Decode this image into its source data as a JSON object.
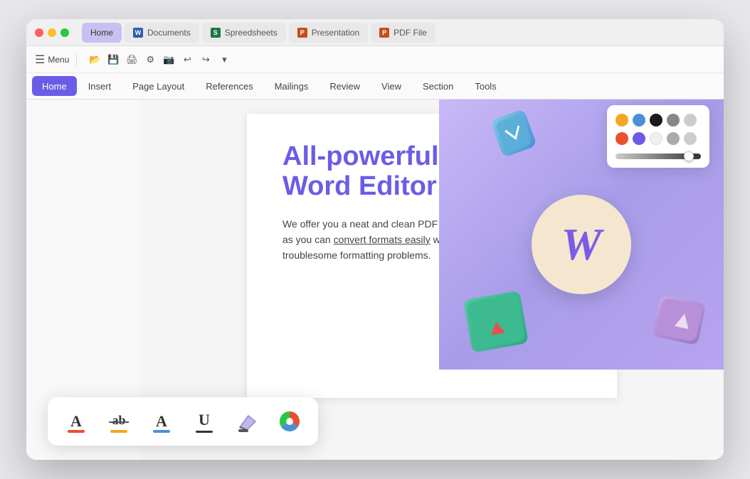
{
  "window": {
    "title": "Word Editor"
  },
  "titlebar": {
    "tabs": [
      {
        "id": "home",
        "label": "Home",
        "icon": null,
        "active": true
      },
      {
        "id": "documents",
        "label": "Documents",
        "icon": "word",
        "active": false
      },
      {
        "id": "spreadsheets",
        "label": "Spreedsheets",
        "icon": "sheets",
        "active": false
      },
      {
        "id": "presentation",
        "label": "Presentation",
        "icon": "ppt",
        "active": false
      },
      {
        "id": "pdf",
        "label": "PDF File",
        "icon": "pdf",
        "active": false
      }
    ]
  },
  "ribbon": {
    "nav_items": [
      {
        "id": "home",
        "label": "Home",
        "active": true
      },
      {
        "id": "insert",
        "label": "Insert",
        "active": false
      },
      {
        "id": "page_layout",
        "label": "Page Layout",
        "active": false
      },
      {
        "id": "references",
        "label": "References",
        "active": false
      },
      {
        "id": "mailings",
        "label": "Mailings",
        "active": false
      },
      {
        "id": "review",
        "label": "Review",
        "active": false
      },
      {
        "id": "view",
        "label": "View",
        "active": false
      },
      {
        "id": "section",
        "label": "Section",
        "active": false
      },
      {
        "id": "tools",
        "label": "Tools",
        "active": false
      }
    ]
  },
  "document": {
    "title_line1": "All-powerful",
    "title_line2": "Word Editor",
    "body": "We offer you a neat and clean PDF document as you can convert formats easily without troublesome formatting problems.",
    "underline_text": "convert formats easily"
  },
  "color_picker": {
    "row1": [
      "#f5a623",
      "#4a90d9",
      "#1a1a1a",
      "#888888",
      "#cccccc"
    ],
    "row2": [
      "#e85030",
      "#6b5ce7",
      "#ffffff",
      "#aaaaaa",
      "#cccccc"
    ]
  },
  "bottom_toolbar": {
    "tools": [
      {
        "id": "text-color",
        "label": "Text Color"
      },
      {
        "id": "strikethrough",
        "label": "Strikethrough"
      },
      {
        "id": "font-color",
        "label": "Font Color"
      },
      {
        "id": "underline",
        "label": "Underline"
      },
      {
        "id": "eraser",
        "label": "Eraser"
      },
      {
        "id": "pie-chart",
        "label": "Pie Chart"
      }
    ]
  },
  "menu_label": "Menu"
}
